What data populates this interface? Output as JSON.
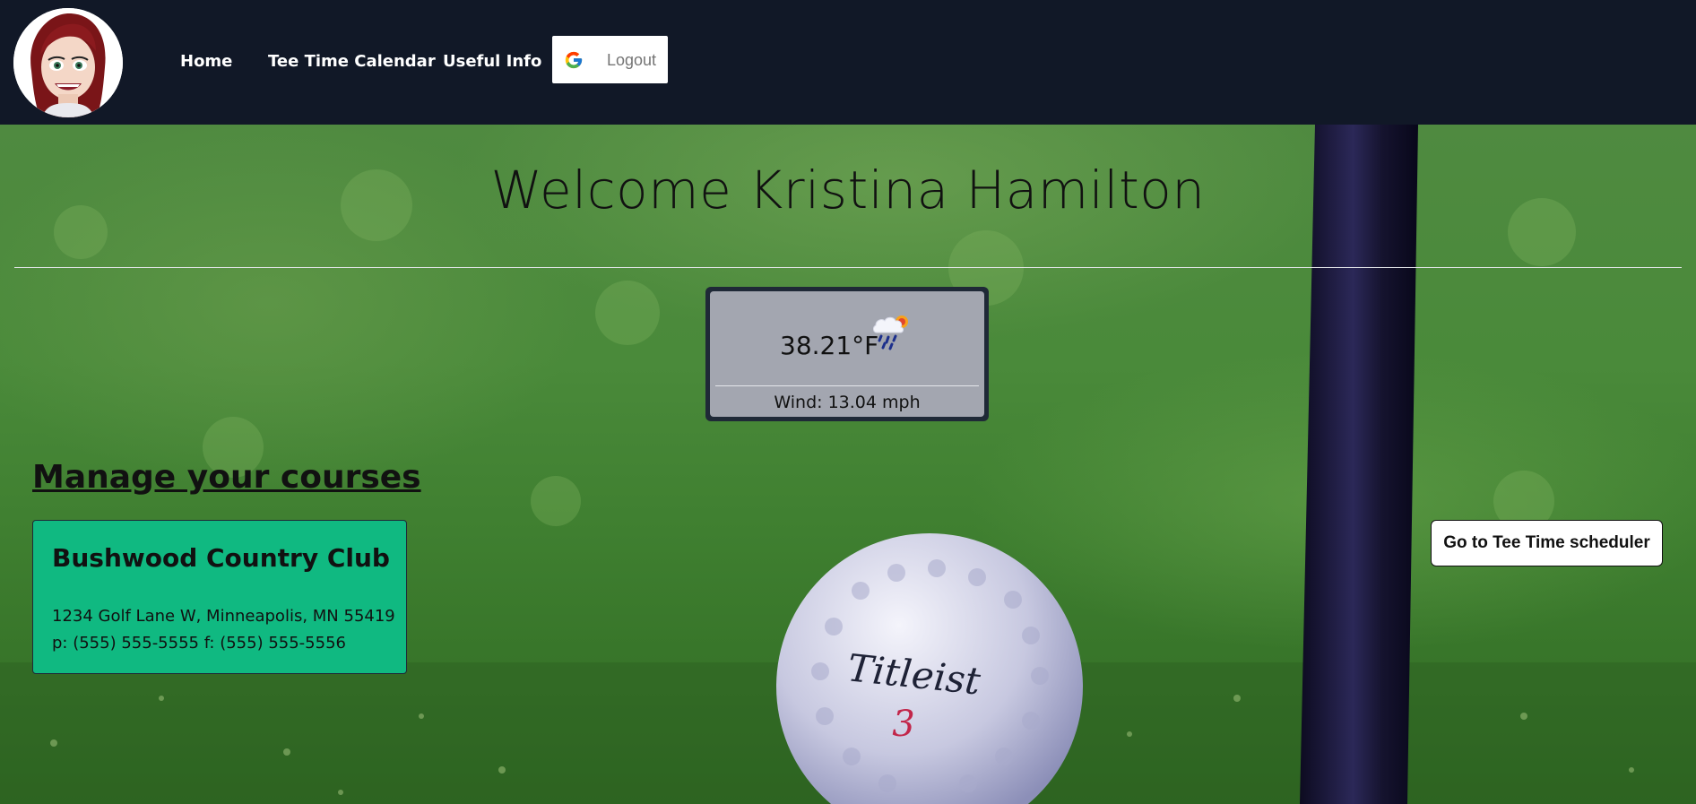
{
  "header": {
    "avatar": "avatar-icon",
    "nav": {
      "home": "Home",
      "calendar": "Tee Time Calendar",
      "info": "Useful Info"
    },
    "logout": {
      "icon": "google-g-icon",
      "label": "Logout"
    }
  },
  "welcome": {
    "title": "Welcome Kristina Hamilton"
  },
  "weather": {
    "temperature": "38.21°F",
    "icon": "rain-snow-sun-icon",
    "wind": "Wind: 13.04 mph"
  },
  "courses": {
    "heading": "Manage your courses",
    "items": [
      {
        "name": "Bushwood Country Club",
        "address": "1234 Golf Lane W, Minneapolis, MN 55419",
        "phone": "p: (555) 555-5555 f: (555) 555-5556"
      }
    ]
  },
  "actions": {
    "scheduler": "Go to Tee Time scheduler"
  },
  "background": {
    "ball_brand": "Titleist",
    "ball_number": "3"
  },
  "colors": {
    "header_bg": "#111827",
    "card_bg": "#10b981",
    "weather_bg": "#a3a6b0"
  }
}
